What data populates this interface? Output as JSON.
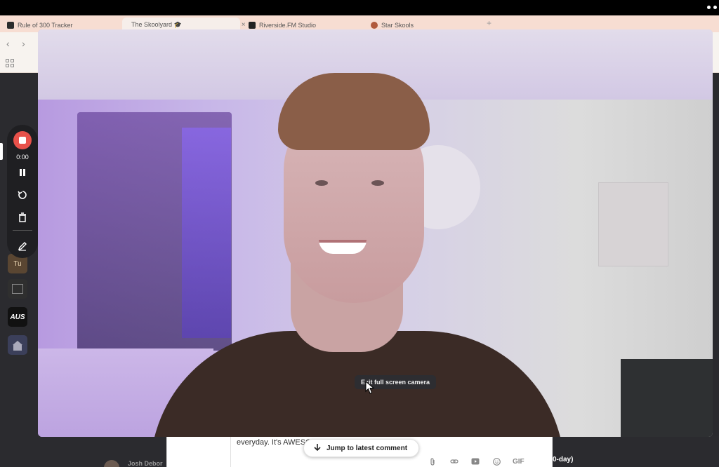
{
  "browser": {
    "tabs": [
      {
        "title": "Rule of 300 Tracker",
        "favicon_color": "#2b2b2b"
      },
      {
        "title": "The Skoolyard 🎓",
        "favicon_color": "#d9534f",
        "active": true,
        "close_glyph": "×"
      },
      {
        "title": "Riverside.FM Studio",
        "favicon_color": "#222222"
      },
      {
        "title": "Star Skools",
        "favicon_color": "#b05a3c"
      }
    ],
    "new_tab_glyph": "+"
  },
  "recorder": {
    "timer": "0:00",
    "tools": [
      "pause-icon",
      "restart-icon",
      "delete-icon",
      "draw-icon"
    ]
  },
  "sidebar": {
    "app_icons": [
      {
        "name": "tu-app-icon",
        "label": "Tu",
        "color": "#5a4632"
      },
      {
        "name": "calendar-app-icon",
        "label": "",
        "color": "#2f2f2f"
      },
      {
        "name": "aus-app-icon",
        "label": "AUS",
        "color": "#111111"
      },
      {
        "name": "home-app-icon",
        "label": "",
        "color": "#3b3f5a"
      }
    ]
  },
  "camera": {
    "tooltip": "Exit full screen camera"
  },
  "composer": {
    "text": "everyday. It's AWESO",
    "icons": [
      "attach-icon",
      "link-icon",
      "video-icon",
      "emoji-icon"
    ],
    "gif_label": "GIF"
  },
  "jump_button": {
    "label": "Jump to latest comment"
  },
  "comment_author": "Josh Debor",
  "post_title_fragment": "0-day)"
}
